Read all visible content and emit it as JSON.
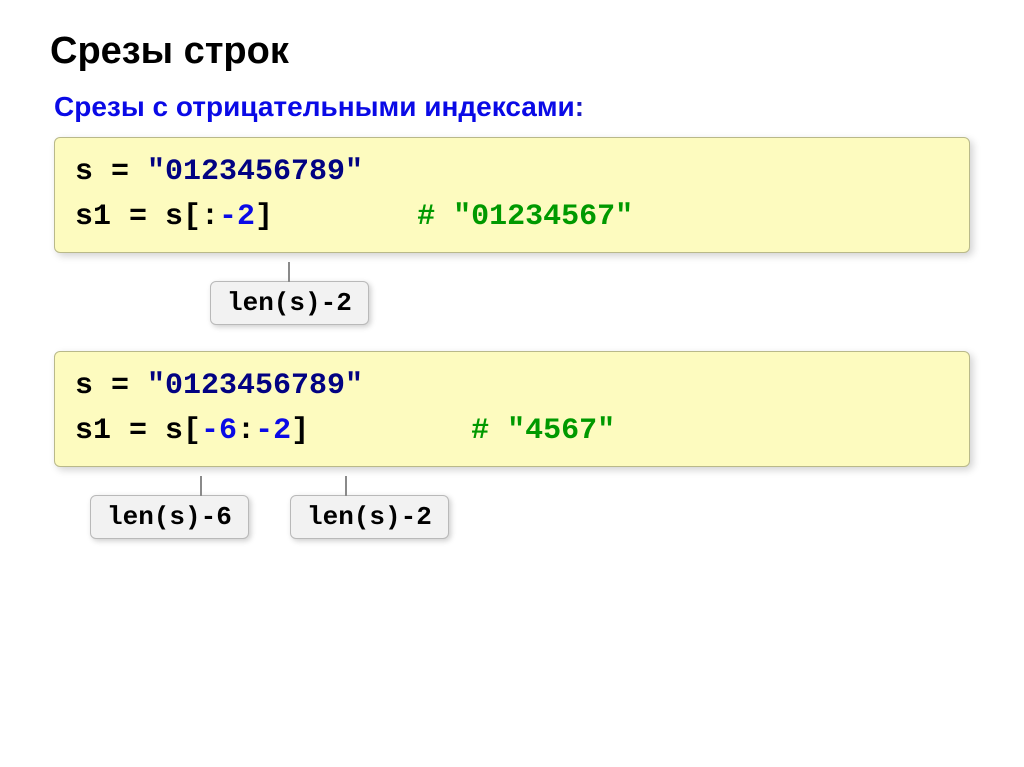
{
  "title": "Срезы строк",
  "subtitle_parts": {
    "t1": "Срезы с отрицательными индексами",
    "colon": ":"
  },
  "block1": {
    "line1_parts": {
      "a": "s = ",
      "b": "\"0123456789\""
    },
    "line2_parts": {
      "a": "s1 = s[:",
      "b": "-2",
      "c": "]",
      "pad": "        ",
      "d": "#",
      "e": " \"01234567\""
    }
  },
  "callout1": {
    "text": "len(s)-2"
  },
  "block2": {
    "line1_parts": {
      "a": "s = ",
      "b": "\"0123456789\""
    },
    "line2_parts": {
      "a": "s1 = s[",
      "b": "-6",
      "c": ":",
      "d": "-2",
      "e": "]",
      "pad": "         ",
      "f": "#",
      "g": " \"4567\""
    }
  },
  "callout2a": {
    "text": "len(s)-6"
  },
  "callout2b": {
    "text": "len(s)-2"
  }
}
